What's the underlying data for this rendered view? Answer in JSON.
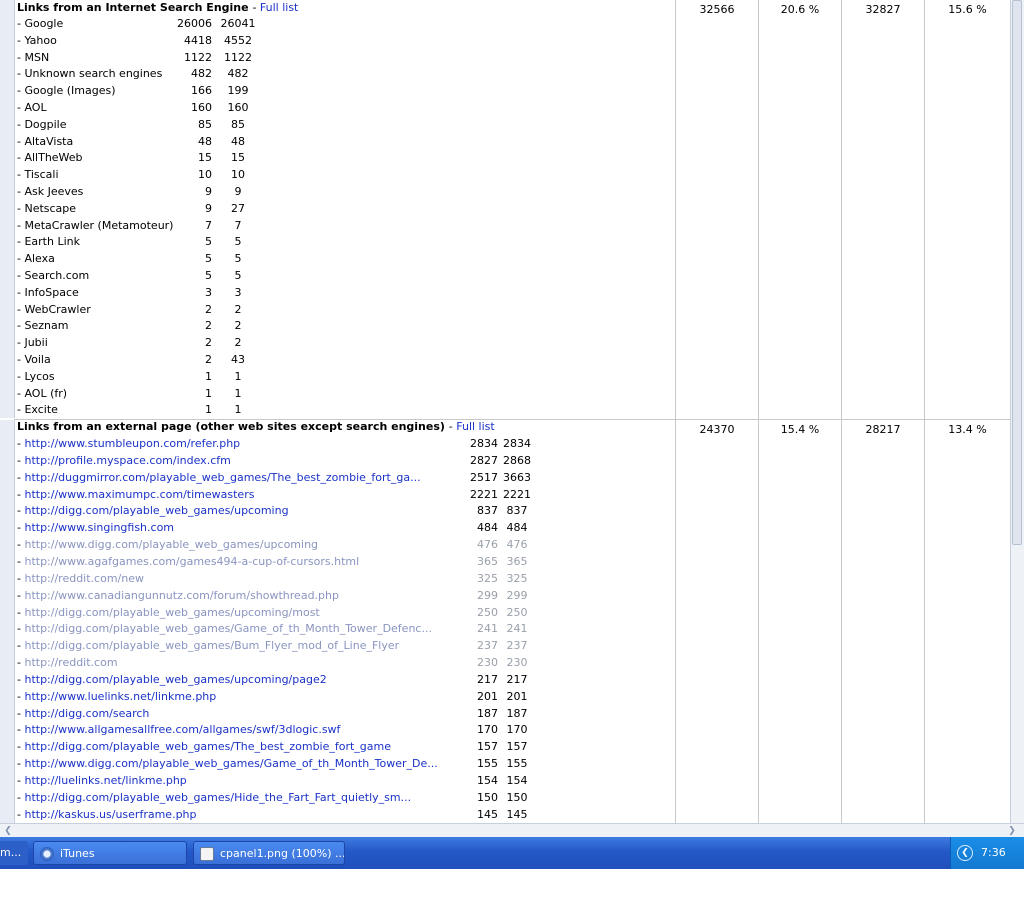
{
  "search_section": {
    "title": "Links from an Internet Search Engine",
    "full_list": "Full list",
    "stats": [
      "32566",
      "20.6 %",
      "32827",
      "15.6 %"
    ],
    "rows": [
      {
        "name": "- Google",
        "pages": "26006",
        "hits": "26041"
      },
      {
        "name": "- Yahoo",
        "pages": "4418",
        "hits": "4552"
      },
      {
        "name": "- MSN",
        "pages": "1122",
        "hits": "1122"
      },
      {
        "name": "- Unknown search engines",
        "pages": "482",
        "hits": "482"
      },
      {
        "name": "- Google (Images)",
        "pages": "166",
        "hits": "199"
      },
      {
        "name": "- AOL",
        "pages": "160",
        "hits": "160"
      },
      {
        "name": "- Dogpile",
        "pages": "85",
        "hits": "85"
      },
      {
        "name": "- AltaVista",
        "pages": "48",
        "hits": "48"
      },
      {
        "name": "- AllTheWeb",
        "pages": "15",
        "hits": "15"
      },
      {
        "name": "- Tiscali",
        "pages": "10",
        "hits": "10"
      },
      {
        "name": "- Ask Jeeves",
        "pages": "9",
        "hits": "9"
      },
      {
        "name": "- Netscape",
        "pages": "9",
        "hits": "27"
      },
      {
        "name": "- MetaCrawler (Metamoteur)",
        "pages": "7",
        "hits": "7"
      },
      {
        "name": "- Earth Link",
        "pages": "5",
        "hits": "5"
      },
      {
        "name": "- Alexa",
        "pages": "5",
        "hits": "5"
      },
      {
        "name": "- Search.com",
        "pages": "5",
        "hits": "5"
      },
      {
        "name": "- InfoSpace",
        "pages": "3",
        "hits": "3"
      },
      {
        "name": "- WebCrawler",
        "pages": "2",
        "hits": "2"
      },
      {
        "name": "- Seznam",
        "pages": "2",
        "hits": "2"
      },
      {
        "name": "- Jubii",
        "pages": "2",
        "hits": "2"
      },
      {
        "name": "- Voila",
        "pages": "2",
        "hits": "43"
      },
      {
        "name": "- Lycos",
        "pages": "1",
        "hits": "1"
      },
      {
        "name": "- AOL (fr)",
        "pages": "1",
        "hits": "1"
      },
      {
        "name": "- Excite",
        "pages": "1",
        "hits": "1"
      }
    ]
  },
  "external_section": {
    "title": "Links from an external page (other web sites except search engines)",
    "full_list": "Full list",
    "stats": [
      "24370",
      "15.4 %",
      "28217",
      "13.4 %"
    ],
    "rows": [
      {
        "prefix": "- ",
        "url": "http://www.stumbleupon.com/refer.php",
        "pages": "2834",
        "hits": "2834",
        "style": "link"
      },
      {
        "prefix": "- ",
        "url": "http://profile.myspace.com/index.cfm",
        "pages": "2827",
        "hits": "2868",
        "style": "link"
      },
      {
        "prefix": "- ",
        "url": "http://duggmirror.com/playable_web_games/The_best_zombie_fort_ga...",
        "pages": "2517",
        "hits": "3663",
        "style": "link"
      },
      {
        "prefix": "- ",
        "url": "http://www.maximumpc.com/timewasters",
        "pages": "2221",
        "hits": "2221",
        "style": "link"
      },
      {
        "prefix": "- ",
        "url": "http://digg.com/playable_web_games/upcoming",
        "pages": "837",
        "hits": "837",
        "style": "link"
      },
      {
        "prefix": "- ",
        "url": "http://www.singingfish.com",
        "pages": "484",
        "hits": "484",
        "style": "link"
      },
      {
        "prefix": "- ",
        "url": "http://www.digg.com/playable_web_games/upcoming",
        "pages": "476",
        "hits": "476",
        "style": "visited"
      },
      {
        "prefix": "- ",
        "url": "http://www.agafgames.com/games494-a-cup-of-cursors.html",
        "pages": "365",
        "hits": "365",
        "style": "visited"
      },
      {
        "prefix": "- ",
        "url": "http://reddit.com/new",
        "pages": "325",
        "hits": "325",
        "style": "visited"
      },
      {
        "prefix": "- ",
        "url": "http://www.canadiangunnutz.com/forum/showthread.php",
        "pages": "299",
        "hits": "299",
        "style": "visited"
      },
      {
        "prefix": "- ",
        "url": "http://digg.com/playable_web_games/upcoming/most",
        "pages": "250",
        "hits": "250",
        "style": "visited"
      },
      {
        "prefix": "- ",
        "url": "http://digg.com/playable_web_games/Game_of_th_Month_Tower_Defenc...",
        "pages": "241",
        "hits": "241",
        "style": "visited"
      },
      {
        "prefix": "- ",
        "url": "http://digg.com/playable_web_games/Bum_Flyer_mod_of_Line_Flyer",
        "pages": "237",
        "hits": "237",
        "style": "visited"
      },
      {
        "prefix": "- ",
        "url": "http://reddit.com",
        "pages": "230",
        "hits": "230",
        "style": "visited"
      },
      {
        "prefix": "- ",
        "url": "http://digg.com/playable_web_games/upcoming/page2",
        "pages": "217",
        "hits": "217",
        "style": "link"
      },
      {
        "prefix": "- ",
        "url": "http://www.luelinks.net/linkme.php",
        "pages": "201",
        "hits": "201",
        "style": "link"
      },
      {
        "prefix": "- ",
        "url": "http://digg.com/search",
        "pages": "187",
        "hits": "187",
        "style": "link"
      },
      {
        "prefix": "- ",
        "url": "http://www.allgamesallfree.com/allgames/swf/3dlogic.swf",
        "pages": "170",
        "hits": "170",
        "style": "link"
      },
      {
        "prefix": "- ",
        "url": "http://digg.com/playable_web_games/The_best_zombie_fort_game",
        "pages": "157",
        "hits": "157",
        "style": "link"
      },
      {
        "prefix": "- ",
        "url": "http://www.digg.com/playable_web_games/Game_of_th_Month_Tower_De...",
        "pages": "155",
        "hits": "155",
        "style": "link"
      },
      {
        "prefix": "- ",
        "url": "http://luelinks.net/linkme.php",
        "pages": "154",
        "hits": "154",
        "style": "link"
      },
      {
        "prefix": "- ",
        "url": "http://digg.com/playable_web_games/Hide_the_Fart_Fart_quietly_sm...",
        "pages": "150",
        "hits": "150",
        "style": "link"
      },
      {
        "prefix": "- ",
        "url": "http://kaskus.us/userframe.php",
        "pages": "145",
        "hits": "145",
        "style": "link"
      }
    ]
  },
  "taskbar": {
    "start_label": "m...",
    "items": [
      {
        "label": "iTunes",
        "icon": "itunes-icon"
      },
      {
        "label": "cpanel1.png (100%) ...",
        "icon": "image-viewer-icon"
      }
    ],
    "clock": "7:36 PM"
  },
  "colors": {
    "link": "#1a32c8",
    "visited": "#8a94c0",
    "taskbar": "#2458c8",
    "tray": "#1478d0"
  }
}
